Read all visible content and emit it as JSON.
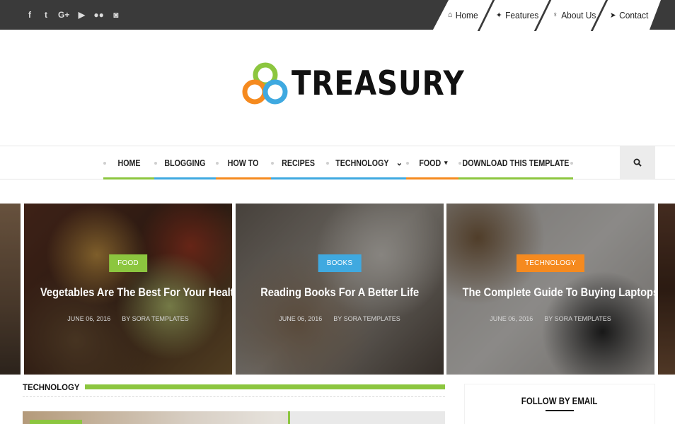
{
  "colors": {
    "topbar": "#3a3a3a",
    "green": "#8cc63f",
    "blue": "#3fa9e0",
    "orange": "#f58a1f"
  },
  "social": [
    {
      "name": "facebook-icon",
      "glyph": "f"
    },
    {
      "name": "twitter-icon",
      "glyph": "t"
    },
    {
      "name": "google-plus-icon",
      "glyph": "G+"
    },
    {
      "name": "youtube-icon",
      "glyph": "▶"
    },
    {
      "name": "flickr-icon",
      "glyph": "●●"
    },
    {
      "name": "instagram-icon",
      "glyph": "◙"
    }
  ],
  "topnav": [
    {
      "label": "Home",
      "icon": "home-icon",
      "glyph": "⌂"
    },
    {
      "label": "Features",
      "icon": "gamepad-icon",
      "glyph": "✦"
    },
    {
      "label": "About Us",
      "icon": "lightbulb-icon",
      "glyph": "♀"
    },
    {
      "label": "Contact",
      "icon": "send-icon",
      "glyph": "➤"
    }
  ],
  "logo": {
    "text": "TREASURY"
  },
  "mainnav": [
    {
      "label": "HOME",
      "accent": "#8cc63f"
    },
    {
      "label": "BLOGGING",
      "accent": "#3fa9e0"
    },
    {
      "label": "HOW TO",
      "accent": "#f58a1f"
    },
    {
      "label": "RECIPES",
      "accent": "#3fa9e0"
    },
    {
      "label": "TECHNOLOGY",
      "accent": "#3fa9e0",
      "caret": "⌄"
    },
    {
      "label": "FOOD",
      "accent": "#f58a1f",
      "caret": "▾"
    },
    {
      "label": "DOWNLOAD THIS TEMPLATE",
      "accent": "#8cc63f"
    }
  ],
  "slides": [
    {
      "tag": "FOOD",
      "tag_color": "#8cc63f",
      "title": "Vegetables Are The Best For Your Health",
      "date": "JUNE 06, 2016",
      "author": "BY SORA TEMPLATES"
    },
    {
      "tag": "BOOKS",
      "tag_color": "#3fa9e0",
      "title": "Reading Books For A Better Life",
      "date": "JUNE 06, 2016",
      "author": "BY SORA TEMPLATES"
    },
    {
      "tag": "TECHNOLOGY",
      "tag_color": "#f58a1f",
      "title": "The Complete Guide To Buying Laptops",
      "date": "JUNE 06, 2016",
      "author": "BY SORA TEMPLATES"
    }
  ],
  "section": {
    "title": "TECHNOLOGY"
  },
  "widget": {
    "title": "FOLLOW BY EMAIL"
  }
}
